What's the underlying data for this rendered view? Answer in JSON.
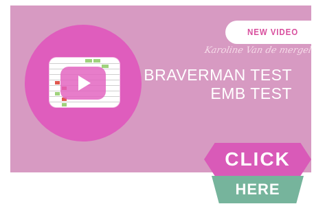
{
  "banner": {
    "badge": "NEW VIDEO",
    "author": "Karoline Van de mergel",
    "title_line1": "BRAVERMAN TEST",
    "title_line2": "EMB TEST"
  },
  "video": {
    "play_icon": "play-icon"
  },
  "cta": {
    "click": "CLICK",
    "here": "HERE"
  },
  "colors": {
    "banner_bg": "#d79ac2",
    "circle": "#df5dbd",
    "badge_text": "#d84f9e",
    "click_bg": "#d95ab8",
    "here_bg": "#76b49c"
  }
}
